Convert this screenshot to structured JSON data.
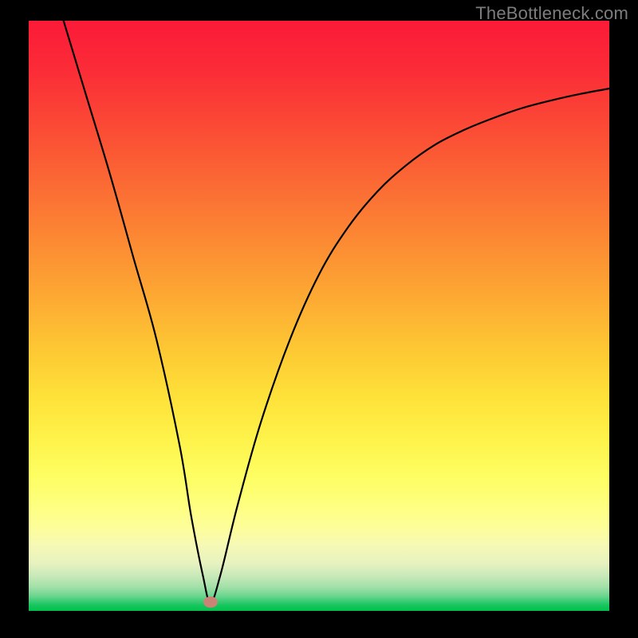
{
  "watermark": "TheBottleneck.com",
  "marker": {
    "x_frac": 0.313,
    "y_frac": 0.985
  },
  "chart_data": {
    "type": "line",
    "title": "",
    "xlabel": "",
    "ylabel": "",
    "xlim": [
      0,
      100
    ],
    "ylim": [
      0,
      100
    ],
    "annotations": [
      "TheBottleneck.com"
    ],
    "series": [
      {
        "name": "curve",
        "x": [
          6,
          10,
          14,
          18,
          22,
          26,
          28,
          30,
          31.3,
          33,
          36,
          40,
          45,
          50,
          55,
          60,
          65,
          70,
          75,
          80,
          85,
          90,
          95,
          100
        ],
        "y": [
          100,
          87,
          74,
          60,
          46,
          28,
          16,
          6,
          1.5,
          6,
          18,
          32,
          46,
          57,
          65,
          71,
          75.5,
          79,
          81.5,
          83.5,
          85.2,
          86.5,
          87.6,
          88.5
        ]
      }
    ],
    "marker_point": {
      "x": 31.3,
      "y": 1.5
    },
    "background_gradient": {
      "top_color": "#fb1a38",
      "mid_color": "#fee23a",
      "bottom_color": "#00c24a"
    }
  }
}
